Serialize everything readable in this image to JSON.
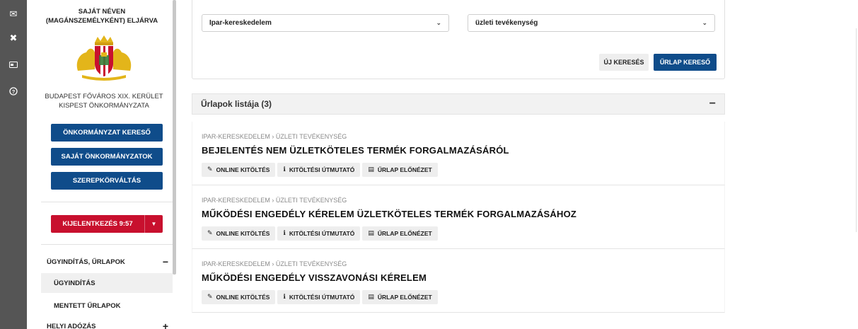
{
  "rail": [
    {
      "name": "mail-icon",
      "glyph": "✉"
    },
    {
      "name": "tools-icon",
      "glyph": "✖"
    },
    {
      "name": "id-card-icon",
      "glyph": "▭"
    },
    {
      "name": "help-icon",
      "glyph": "?"
    }
  ],
  "sidebar": {
    "title": "SAJÁT NÉVEN (MAGÁNSZEMÉLYKÉNT) ELJÁRVA",
    "org": "BUDAPEST FŐVÁROS XIX. KERÜLET KISPEST ÖNKORMÁNYZATA",
    "btn_search_muni": "ÖNKORMÁNYZAT KERESŐ",
    "btn_own_muni": "SAJÁT ÖNKORMÁNYZATOK",
    "btn_role": "SZEREPKÖRVÁLTÁS",
    "logout": "KIJELENTKEZÉS 9:57",
    "menu1": "ÜGYINDÍTÁS, ŰRLAPOK",
    "menu1_sub1": "ÜGYINDÍTÁS",
    "menu1_sub2": "MENTETT ŰRLAPOK",
    "menu2": "HELYI ADÓZÁS",
    "minus": "−",
    "plus": "+"
  },
  "search": {
    "category": "Ipar-kereskedelem",
    "subcategory": "üzleti tevékenység",
    "new_search": "ÚJ KERESÉS",
    "form_search": "ŰRLAP KERESŐ"
  },
  "list": {
    "header": "Űrlapok listája (3)",
    "collapse": "−",
    "items": [
      {
        "crumb": "IPAR-KERESKEDELEM › ÜZLETI TEVÉKENYSÉG",
        "title": "BEJELENTÉS NEM ÜZLETKÖTELES TERMÉK FORGALMAZÁSÁRÓL"
      },
      {
        "crumb": "IPAR-KERESKEDELEM › ÜZLETI TEVÉKENYSÉG",
        "title": "MŰKÖDÉSI ENGEDÉLY KÉRELEM ÜZLETKÖTELES TERMÉK FORGALMAZÁSÁHOZ"
      },
      {
        "crumb": "IPAR-KERESKEDELEM › ÜZLETI TEVÉKENYSÉG",
        "title": "MŰKÖDÉSI ENGEDÉLY VISSZAVONÁSI KÉRELEM"
      }
    ],
    "actions": {
      "online": "ONLINE KITÖLTÉS",
      "guide": "KITÖLTÉSI ÚTMUTATÓ",
      "preview": "ŰRLAP ELŐNÉZET"
    }
  },
  "colors": {
    "primary": "#0f4c8a",
    "danger": "#c8102e",
    "rail": "#555555"
  }
}
